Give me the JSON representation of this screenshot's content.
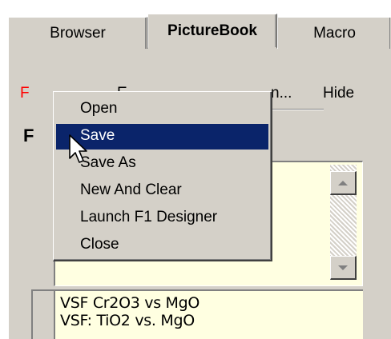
{
  "tabs": [
    {
      "label": "Browser",
      "active": false
    },
    {
      "label": "PictureBook",
      "active": true
    },
    {
      "label": "Macro",
      "active": false
    }
  ],
  "menu_strip": {
    "file": "F",
    "edit": "E",
    "fragment": "n...",
    "hide": "Hide"
  },
  "heading_fragment": "F",
  "context_menu": {
    "items": [
      {
        "label": "Open",
        "selected": false
      },
      {
        "label": "Save",
        "selected": true
      },
      {
        "label": "Save As",
        "selected": false
      },
      {
        "label": "New And Clear",
        "selected": false
      },
      {
        "label": "Launch F1 Designer",
        "selected": false
      },
      {
        "label": "Close",
        "selected": false
      }
    ]
  },
  "list2": {
    "rows": [
      "VSF Cr2O3 vs MgO",
      "VSF: TiO2 vs. MgO"
    ]
  },
  "colors": {
    "face": "#d4d0c8",
    "highlight": "#0a246a",
    "list_bg": "#ffffe1",
    "file_menu_color": "#ff0000"
  },
  "icons": {
    "cursor": "arrow-cursor-icon",
    "scroll_up": "arrow-up-icon",
    "scroll_down": "arrow-down-icon"
  }
}
